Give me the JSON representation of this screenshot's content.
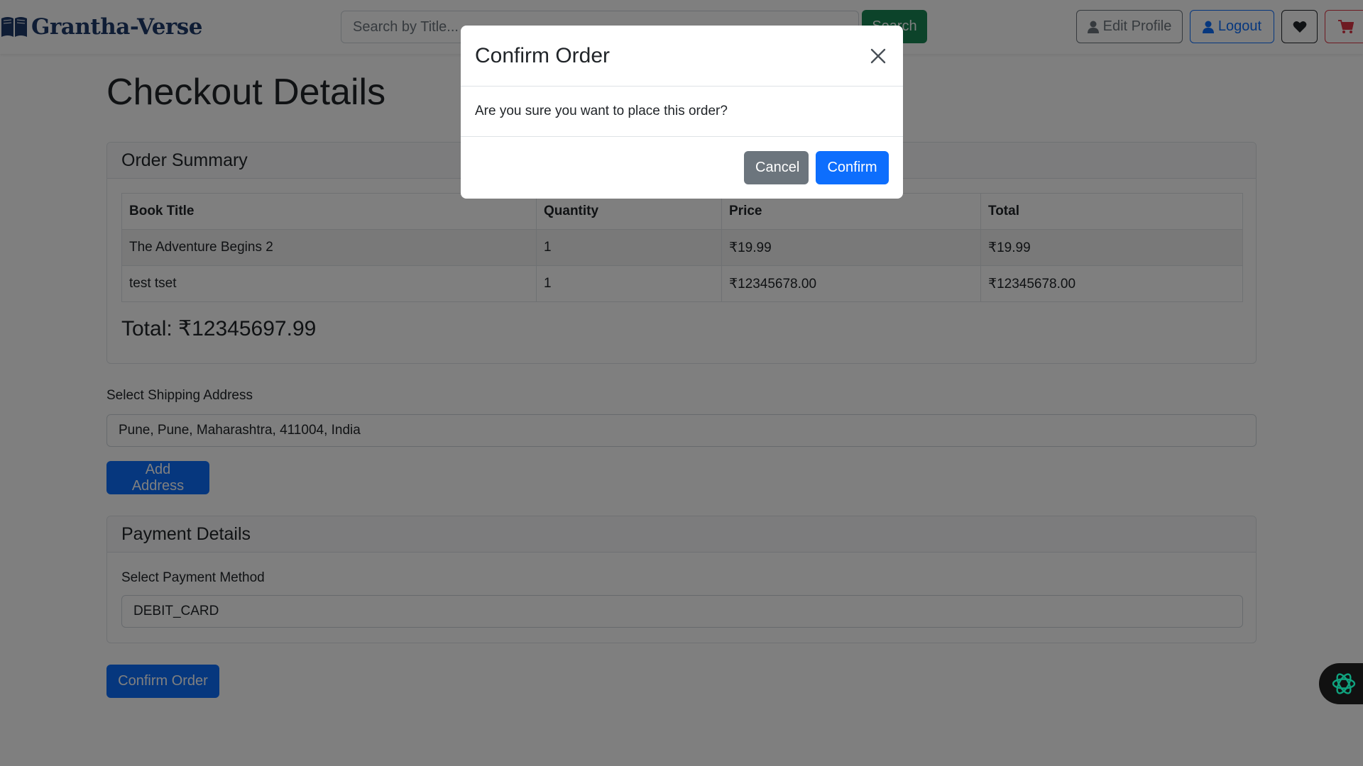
{
  "navbar": {
    "brand_name": "Grantha-Verse",
    "search_placeholder": "Search by Title...",
    "search_label": "Search",
    "edit_profile_label": "Edit Profile",
    "logout_label": "Logout"
  },
  "page": {
    "title": "Checkout Details"
  },
  "order_summary": {
    "header": "Order Summary",
    "columns": [
      "Book Title",
      "Quantity",
      "Price",
      "Total"
    ],
    "rows": [
      [
        "The Adventure Begins 2",
        "1",
        "₹19.99",
        "₹19.99"
      ],
      [
        "test tset",
        "1",
        "₹12345678.00",
        "₹12345678.00"
      ]
    ],
    "total_text": "Total: ₹12345697.99"
  },
  "shipping": {
    "label": "Select Shipping Address",
    "selected": "Pune, Pune, Maharashtra, 411004, India",
    "add_address_label": "Add Address"
  },
  "payment": {
    "header": "Payment Details",
    "label": "Select Payment Method",
    "selected": "DEBIT_CARD"
  },
  "confirm_order_label": "Confirm Order",
  "modal": {
    "title": "Confirm Order",
    "message": "Are you sure you want to place this order?",
    "cancel_label": "Cancel",
    "confirm_label": "Confirm"
  },
  "colors": {
    "primary": "#0d6efd",
    "success": "#198754",
    "secondary": "#6c757d",
    "danger": "#dc3545",
    "brand": "#1f3a6b",
    "assistant_accent": "#10a37f"
  },
  "icons": {
    "brand": "open-book-icon",
    "edit_profile": "user-icon",
    "logout": "user-icon",
    "wishlist": "heart-icon",
    "cart": "cart-icon",
    "close": "close-icon",
    "assistant": "assistant-knot-icon"
  }
}
